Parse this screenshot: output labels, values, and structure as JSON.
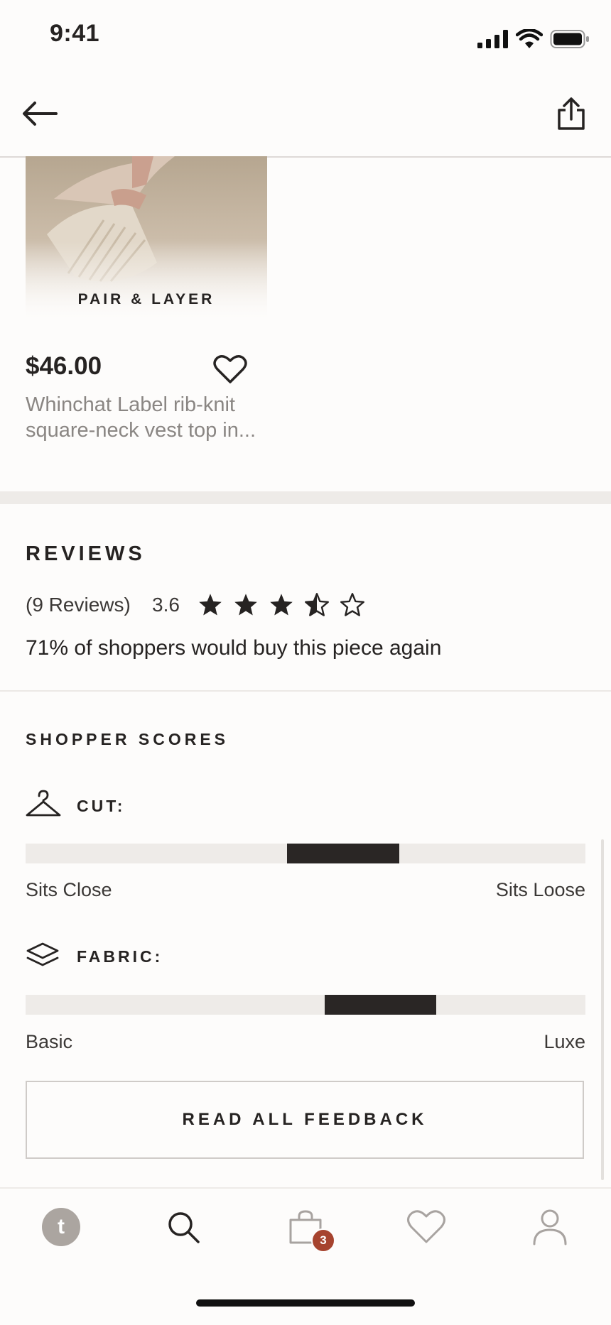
{
  "status_bar": {
    "time": "9:41"
  },
  "product": {
    "image_caption": "PAIR & LAYER",
    "price": "$46.00",
    "title": "Whinchat Label rib-knit square-neck vest top in..."
  },
  "reviews": {
    "heading": "REVIEWS",
    "count_label": "(9 Reviews)",
    "rating": "3.6",
    "stars_filled": 3.5,
    "stars_total": 5,
    "buy_again_text": "71% of shoppers would buy this piece again"
  },
  "shopper_scores": {
    "heading": "SHOPPER SCORES",
    "cut": {
      "label": "CUT:",
      "icon": "hanger-icon",
      "left_label": "Sits Close",
      "right_label": "Sits Loose",
      "range_start": 0.467,
      "range_end": 0.668
    },
    "fabric": {
      "label": "FABRIC:",
      "icon": "layers-icon",
      "left_label": "Basic",
      "right_label": "Luxe",
      "range_start": 0.534,
      "range_end": 0.734
    }
  },
  "feedback_button": {
    "label": "READ ALL FEEDBACK"
  },
  "tab_bar": {
    "home_avatar_letter": "t",
    "bag_count": "3",
    "badge_color": "#a6432e",
    "items": [
      "home-icon",
      "search-icon",
      "bag-icon",
      "heart-icon",
      "account-icon"
    ]
  }
}
